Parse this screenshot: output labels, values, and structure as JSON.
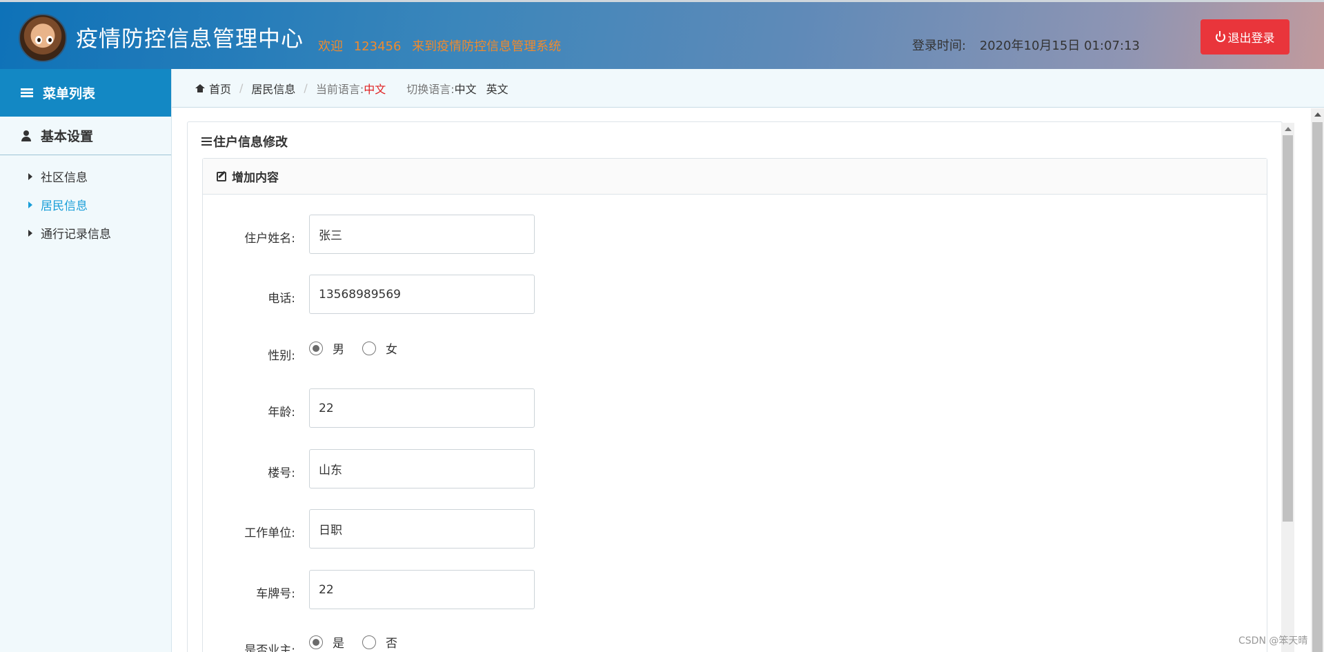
{
  "header": {
    "title": "疫情防控信息管理中心",
    "welcome_prefix": "欢迎",
    "username": "123456",
    "welcome_suffix": "来到疫情防控信息管理系统",
    "login_time_label": "登录时间:",
    "login_time_value": "2020年10月15日 01:07:13",
    "logout_label": "退出登录"
  },
  "sidebar": {
    "menu_title": "菜单列表",
    "group_title": "基本设置",
    "items": [
      {
        "label": "社区信息",
        "active": false
      },
      {
        "label": "居民信息",
        "active": true
      },
      {
        "label": "通行记录信息",
        "active": false
      }
    ]
  },
  "breadcrumb": {
    "home": "首页",
    "current": "居民信息",
    "lang_label": "当前语言:",
    "lang_value": "中文",
    "switch_label": "切换语言:",
    "switch_options": [
      "中文",
      "英文"
    ]
  },
  "panel": {
    "title": "住户信息修改",
    "section_title": "增加内容"
  },
  "form": {
    "name": {
      "label": "住户姓名:",
      "value": "张三"
    },
    "phone": {
      "label": "电话:",
      "value": "13568989569"
    },
    "gender": {
      "label": "性别:",
      "options": [
        "男",
        "女"
      ],
      "selected": "男"
    },
    "age": {
      "label": "年龄:",
      "value": "22"
    },
    "building": {
      "label": "楼号:",
      "value": "山东"
    },
    "work": {
      "label": "工作单位:",
      "value": "日职"
    },
    "plate": {
      "label": "车牌号:",
      "value": "22"
    },
    "owner": {
      "label": "是否业主:",
      "options": [
        "是",
        "否"
      ],
      "selected": "是"
    }
  },
  "watermark": "CSDN @笨天晴",
  "colors": {
    "accent": "#1388c4",
    "logout": "#e9353b",
    "welcome": "#f08a2c",
    "active_item": "#1a9ed8",
    "current_lang": "#e02020"
  },
  "icons": {
    "menu": "list-icon",
    "group": "user-icon",
    "home": "home-icon",
    "panel": "bars-icon",
    "section": "edit-icon",
    "logout": "power-icon"
  }
}
